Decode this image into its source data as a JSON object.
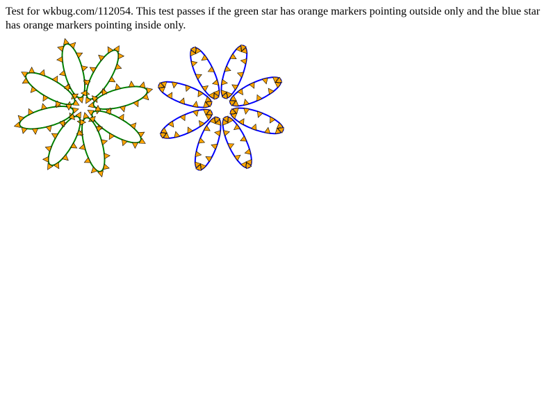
{
  "description": "Test for wkbug.com/112054. This test passes if the green star has orange markers pointing outside only and the blue star has orange markers pointing inside only.",
  "colors": {
    "green_star": "#008000",
    "blue_star": "#0000ff",
    "marker": "#ffa500"
  }
}
